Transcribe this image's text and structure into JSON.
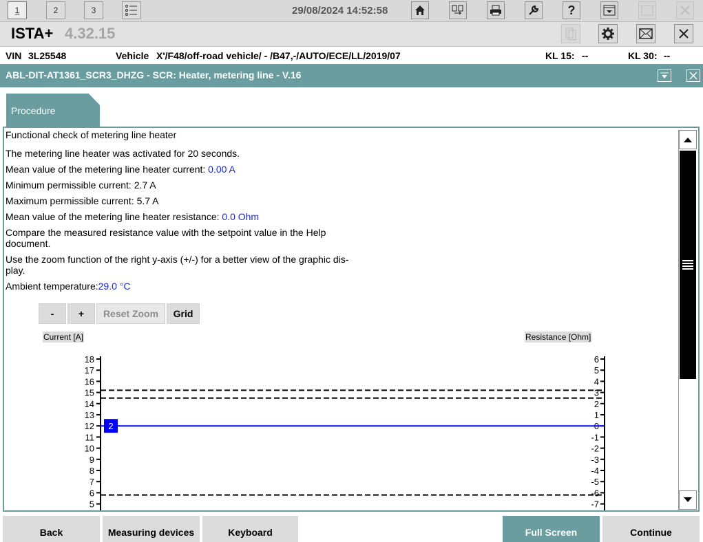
{
  "toolbar": {
    "tabs": [
      "1",
      "2",
      "3"
    ],
    "datetime": "29/08/2024 14:52:58"
  },
  "app": {
    "name": "ISTA+",
    "version": "4.32.15"
  },
  "vehicle_info": {
    "vin_label": "VIN",
    "vin": "3L25548",
    "vehicle_label": "Vehicle",
    "vehicle": "X'/F48/off-road vehicle/ - /B47,-/AUTO/ECE/LL/2019/07",
    "kl15_label": "KL 15:",
    "kl15_value": "--",
    "kl30_label": "KL 30:",
    "kl30_value": "--"
  },
  "module": {
    "title": "ABL-DIT-AT1361_SCR3_DHZG - SCR: Heater, metering line - V.16"
  },
  "procedure_tab": "Procedure",
  "content": {
    "heading": "Functional check of metering line heater",
    "activated": "The metering line heater was activated for 20 seconds.",
    "mean_current_label": "Mean value of the metering line heater current: ",
    "mean_current_value": "0.00 A",
    "min_current": "Minimum permissible current: 2.7 A",
    "max_current": "Maximum permissible current: 5.7 A",
    "mean_resistance_label": "Mean value of the metering line heater resistance: ",
    "mean_resistance_value": "0.0 Ohm",
    "compare_line1": "Compare the measured resistance value with the setpoint value in the Help",
    "compare_line2": "document.",
    "zoom_line1": "Use the zoom function of the right y-axis (+/-) for a better view of the graphic dis-",
    "zoom_line2": "play.",
    "ambient_label": "Ambient temperature:",
    "ambient_value": "29.0 °C"
  },
  "zoom_controls": {
    "minus": "-",
    "plus": "+",
    "reset": "Reset Zoom",
    "grid": "Grid"
  },
  "chart_data": {
    "type": "line",
    "left_axis_label": "Current [A]",
    "right_axis_label": "Resistance [Ohm]",
    "left_ticks": [
      18,
      17,
      16,
      15,
      14,
      13,
      12,
      11,
      10,
      9,
      8,
      7,
      6,
      5
    ],
    "right_ticks": [
      6,
      5,
      4,
      3,
      2,
      1,
      0,
      -1,
      -2,
      -3,
      -4,
      -5,
      -6,
      -7
    ],
    "left_ylim_visible": [
      5,
      18
    ],
    "right_ylim_visible": [
      -7,
      6
    ],
    "reference_lines_right_axis": [
      3.2,
      2.5,
      -6.2
    ],
    "series": [
      {
        "marker_label": "2",
        "axis": "right",
        "constant_value": 0,
        "color": "#0000ff"
      }
    ]
  },
  "bottom_buttons": {
    "back": "Back",
    "measuring": "Measuring devices",
    "keyboard": "Keyboard",
    "fullscreen": "Full Screen",
    "continue": "Continue"
  },
  "colors": {
    "accent": "#6a9d9f",
    "value_text": "#1a28c8",
    "series": "#0000ff"
  }
}
